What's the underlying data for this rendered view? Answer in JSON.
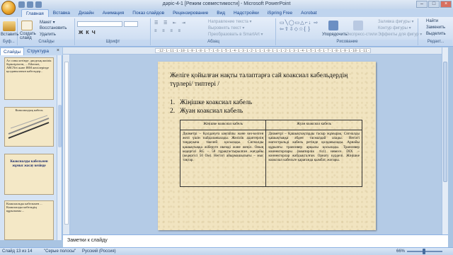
{
  "window": {
    "title": "дәріс-4-1 [Режим совместимости] - Microsoft PowerPoint",
    "controls": [
      "–",
      "□",
      "×"
    ]
  },
  "ribbon_tabs": [
    {
      "label": "Главная",
      "active": true
    },
    {
      "label": "Вставка"
    },
    {
      "label": "Дизайн"
    },
    {
      "label": "Анимация"
    },
    {
      "label": "Показ слайдов"
    },
    {
      "label": "Рецензирование"
    },
    {
      "label": "Вид"
    },
    {
      "label": "Надстройки"
    },
    {
      "label": "iSpring Free"
    },
    {
      "label": "Acrobat"
    }
  ],
  "ribbon": {
    "clipboard": {
      "paste": "Вставить",
      "label": "Буф..."
    },
    "slides": {
      "new_slide": "Создать слайд",
      "layout": "Макет ▾",
      "reset": "Восстановить",
      "delete": "Удалить",
      "label": "Слайды"
    },
    "font": {
      "label": "Шрифт"
    },
    "paragraph": {
      "direction": "Направление текста ▾",
      "align": "Выровнять текст ▾",
      "smartart": "Преобразовать в SmartArt ▾",
      "label": "Абзац"
    },
    "drawing": {
      "arrange": "Упорядочить",
      "styles": "Экспресс-стили",
      "fill": "Заливка фигуры ▾",
      "outline": "Контур фигуры ▾",
      "effects": "Эффекты для фигур ▾",
      "label": "Рисование"
    },
    "editing": {
      "find": "Найти",
      "replace": "Заменить",
      "select": "Выделить",
      "label": "Редакт..."
    }
  },
  "left_panel": {
    "tabs": [
      "Слайды",
      "Структура"
    ],
    "close": "×",
    "thumbs": [
      {
        "text": "Ал соны кезінде: диодтық жиілік біріктірілген, ... Ethernet, ARCNet және IBM желілерінде қолданылатын кабельдер..."
      },
      {
        "text": "Коаксиалдық кабель"
      },
      {
        "text": "Коаксиалды кабельмен жұмыс жасау кезінде"
      },
      {
        "text": "Коаксиальды кабельмен ... Коаксиалды кабельдің құрылымы ..."
      }
    ]
  },
  "ruler_marks": "·12·1·11·1·10·1·9·1·8·1·7·1·6·1·5·1·4·1·3·1·2·1·1·1·0·1·1·1·2·1·3·1·4·1·5·1·6·1·7·1·8·1·9·1·10·1·11·1·12·",
  "slide": {
    "title": "Желіге қойылған нақты талаптарға сай коаксиал кабельдердің түрлері/ типтері /",
    "list": [
      {
        "num": "1.",
        "text": "Жіңішке коаксиал кабель"
      },
      {
        "num": "2.",
        "text": "Жуан коаксиал кабель"
      }
    ],
    "table": {
      "headers": [
        "Жіңішке коаксиал кабель",
        "Жуан коаксиал кабель"
      ],
      "cells": [
        "Диаметрі – Қолдануға ыңғайлы және кез-келген желі үшін пайдаланылады. Желілік адаптерлің таңдауына тікелей қосылады. Сигналды қашықтыққа жіберуге икемді және жеңіл. Оның кедергісі RG – 58 тұрақтастырылған жағдайы (кедергісі 50 Ом). Негізгі айырмашылығы – мыс тақтар.",
        "Диаметрі – Қашықтықтарды тасыр жұмырақ. Сигналды қашықтыққа әбден тасмалдай алады. Негізгі магистральді кабель ретінде қолданылады. Арнайы құрылғы трансивер арқылы қосылады. Трансивер коннекторлары (вампирлік тісі) немесе DIX – коннекторлар жабдықталған. Орнату күрделі. Жіңішке коаксиал кабельге қарағанда қымбат, жоғары."
      ]
    }
  },
  "notes_placeholder": "Заметки к слайду",
  "status_bar": {
    "slide_info": "Слайд 13 из 14",
    "theme": "\"Серые полосы\"",
    "language": "Русский (Россия)",
    "zoom": "66%"
  }
}
